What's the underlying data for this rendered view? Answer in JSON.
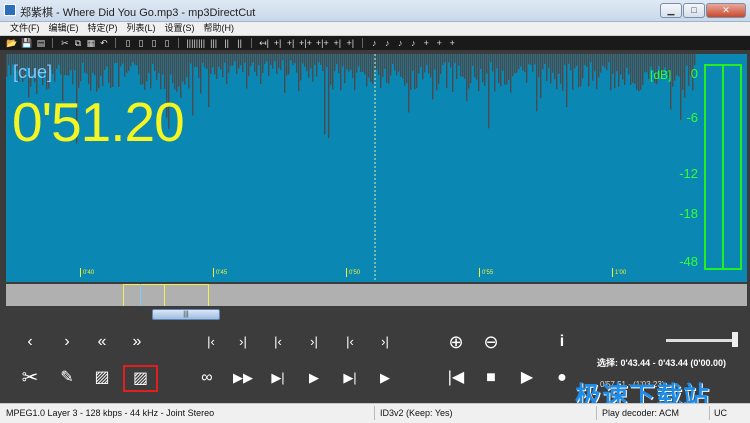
{
  "window": {
    "title": "郑紫棋 - Where Did You Go.mp3 - mp3DirectCut",
    "buttons": {
      "minimize": "▁",
      "maximize": "□",
      "close": "✕"
    }
  },
  "menu": [
    "文件(F)",
    "编辑(E)",
    "特定(P)",
    "列表(L)",
    "设置(S)",
    "帮助(H)"
  ],
  "toolbar": {
    "file": [
      "📂",
      "💾",
      "▤"
    ],
    "edit": [
      "✂",
      "⧉",
      "▦",
      "↶"
    ],
    "view": [
      "▯",
      "▯",
      "▯",
      "▯"
    ],
    "marks": [
      "||||||||",
      "|||",
      "||",
      "||"
    ],
    "cue": [
      "↤|",
      "+|",
      "+|",
      "+|+",
      "+|+",
      "+|",
      "+|"
    ],
    "volume": [
      "♪",
      "♪",
      "♪",
      "♪",
      "+",
      "+",
      "+"
    ]
  },
  "display": {
    "cue_label": "[cue]",
    "time": "0'51.20",
    "db_unit": "[dB]",
    "db_levels": [
      "0",
      "-6",
      "-12",
      "-18",
      "-48"
    ],
    "time_ticks": [
      "0'40",
      "0'45",
      "0'50",
      "0'55",
      "1'00"
    ]
  },
  "overview": {
    "thumb_glyph": "|||"
  },
  "controls": {
    "nav_row": [
      "‹",
      "›",
      "«",
      "»",
      "|‹",
      "›|",
      "|‹",
      "›|",
      "|‹",
      "›|"
    ],
    "zoom_in": "⊕",
    "zoom_out": "⊖",
    "info": "i",
    "edit_row": [
      "✂",
      "✎",
      "▨",
      "▨",
      "∞",
      "▶▶",
      "▶|",
      "▶",
      "▶|",
      "▶"
    ],
    "transport": [
      "|◀",
      "■",
      "▶",
      "●"
    ]
  },
  "selection_text": "选择: 0'43.44 - 0'43.44 (0'00.00)",
  "status_extra": "0'57.51 - (1'03.23)",
  "statusbar": {
    "format": "MPEG1.0 Layer 3 - 128 kbps - 44 kHz - Joint Stereo",
    "tag": "ID3v2 (Keep: Yes)",
    "decoder": "Play decoder: ACM",
    "right": "UC"
  },
  "watermark": "极速下载站",
  "colors": {
    "wave_bg": "#0b87b3",
    "wave_fg": "#4b4b4b",
    "time": "#f5f522",
    "cue": "#7fc9ff",
    "meter": "#22ee22"
  }
}
